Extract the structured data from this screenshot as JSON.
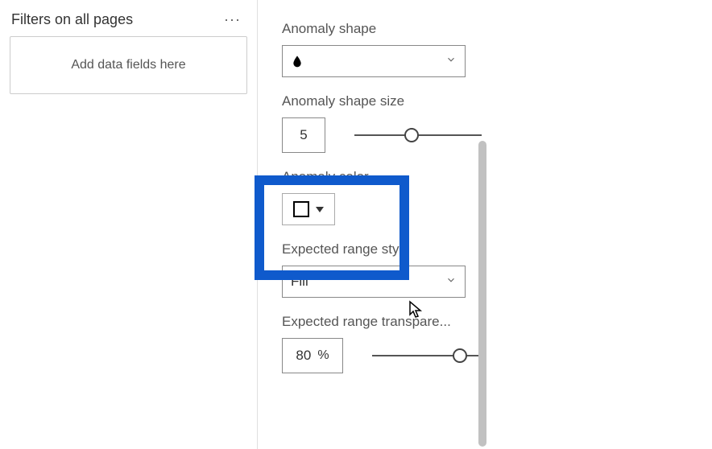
{
  "filters": {
    "title": "Filters on all pages",
    "drop_placeholder": "Add data fields here"
  },
  "format": {
    "anomaly_shape": {
      "label": "Anomaly shape",
      "value_icon": "droplet"
    },
    "anomaly_shape_size": {
      "label": "Anomaly shape size",
      "value": "5",
      "slider_pct": 45
    },
    "anomaly_color": {
      "label": "Anomaly color",
      "swatch": "#ffffff"
    },
    "expected_range_style": {
      "label": "Expected range style",
      "value": "Fill"
    },
    "expected_range_transparency": {
      "label": "Expected range transpare...",
      "value": "80",
      "unit": "%",
      "slider_pct": 80
    }
  }
}
